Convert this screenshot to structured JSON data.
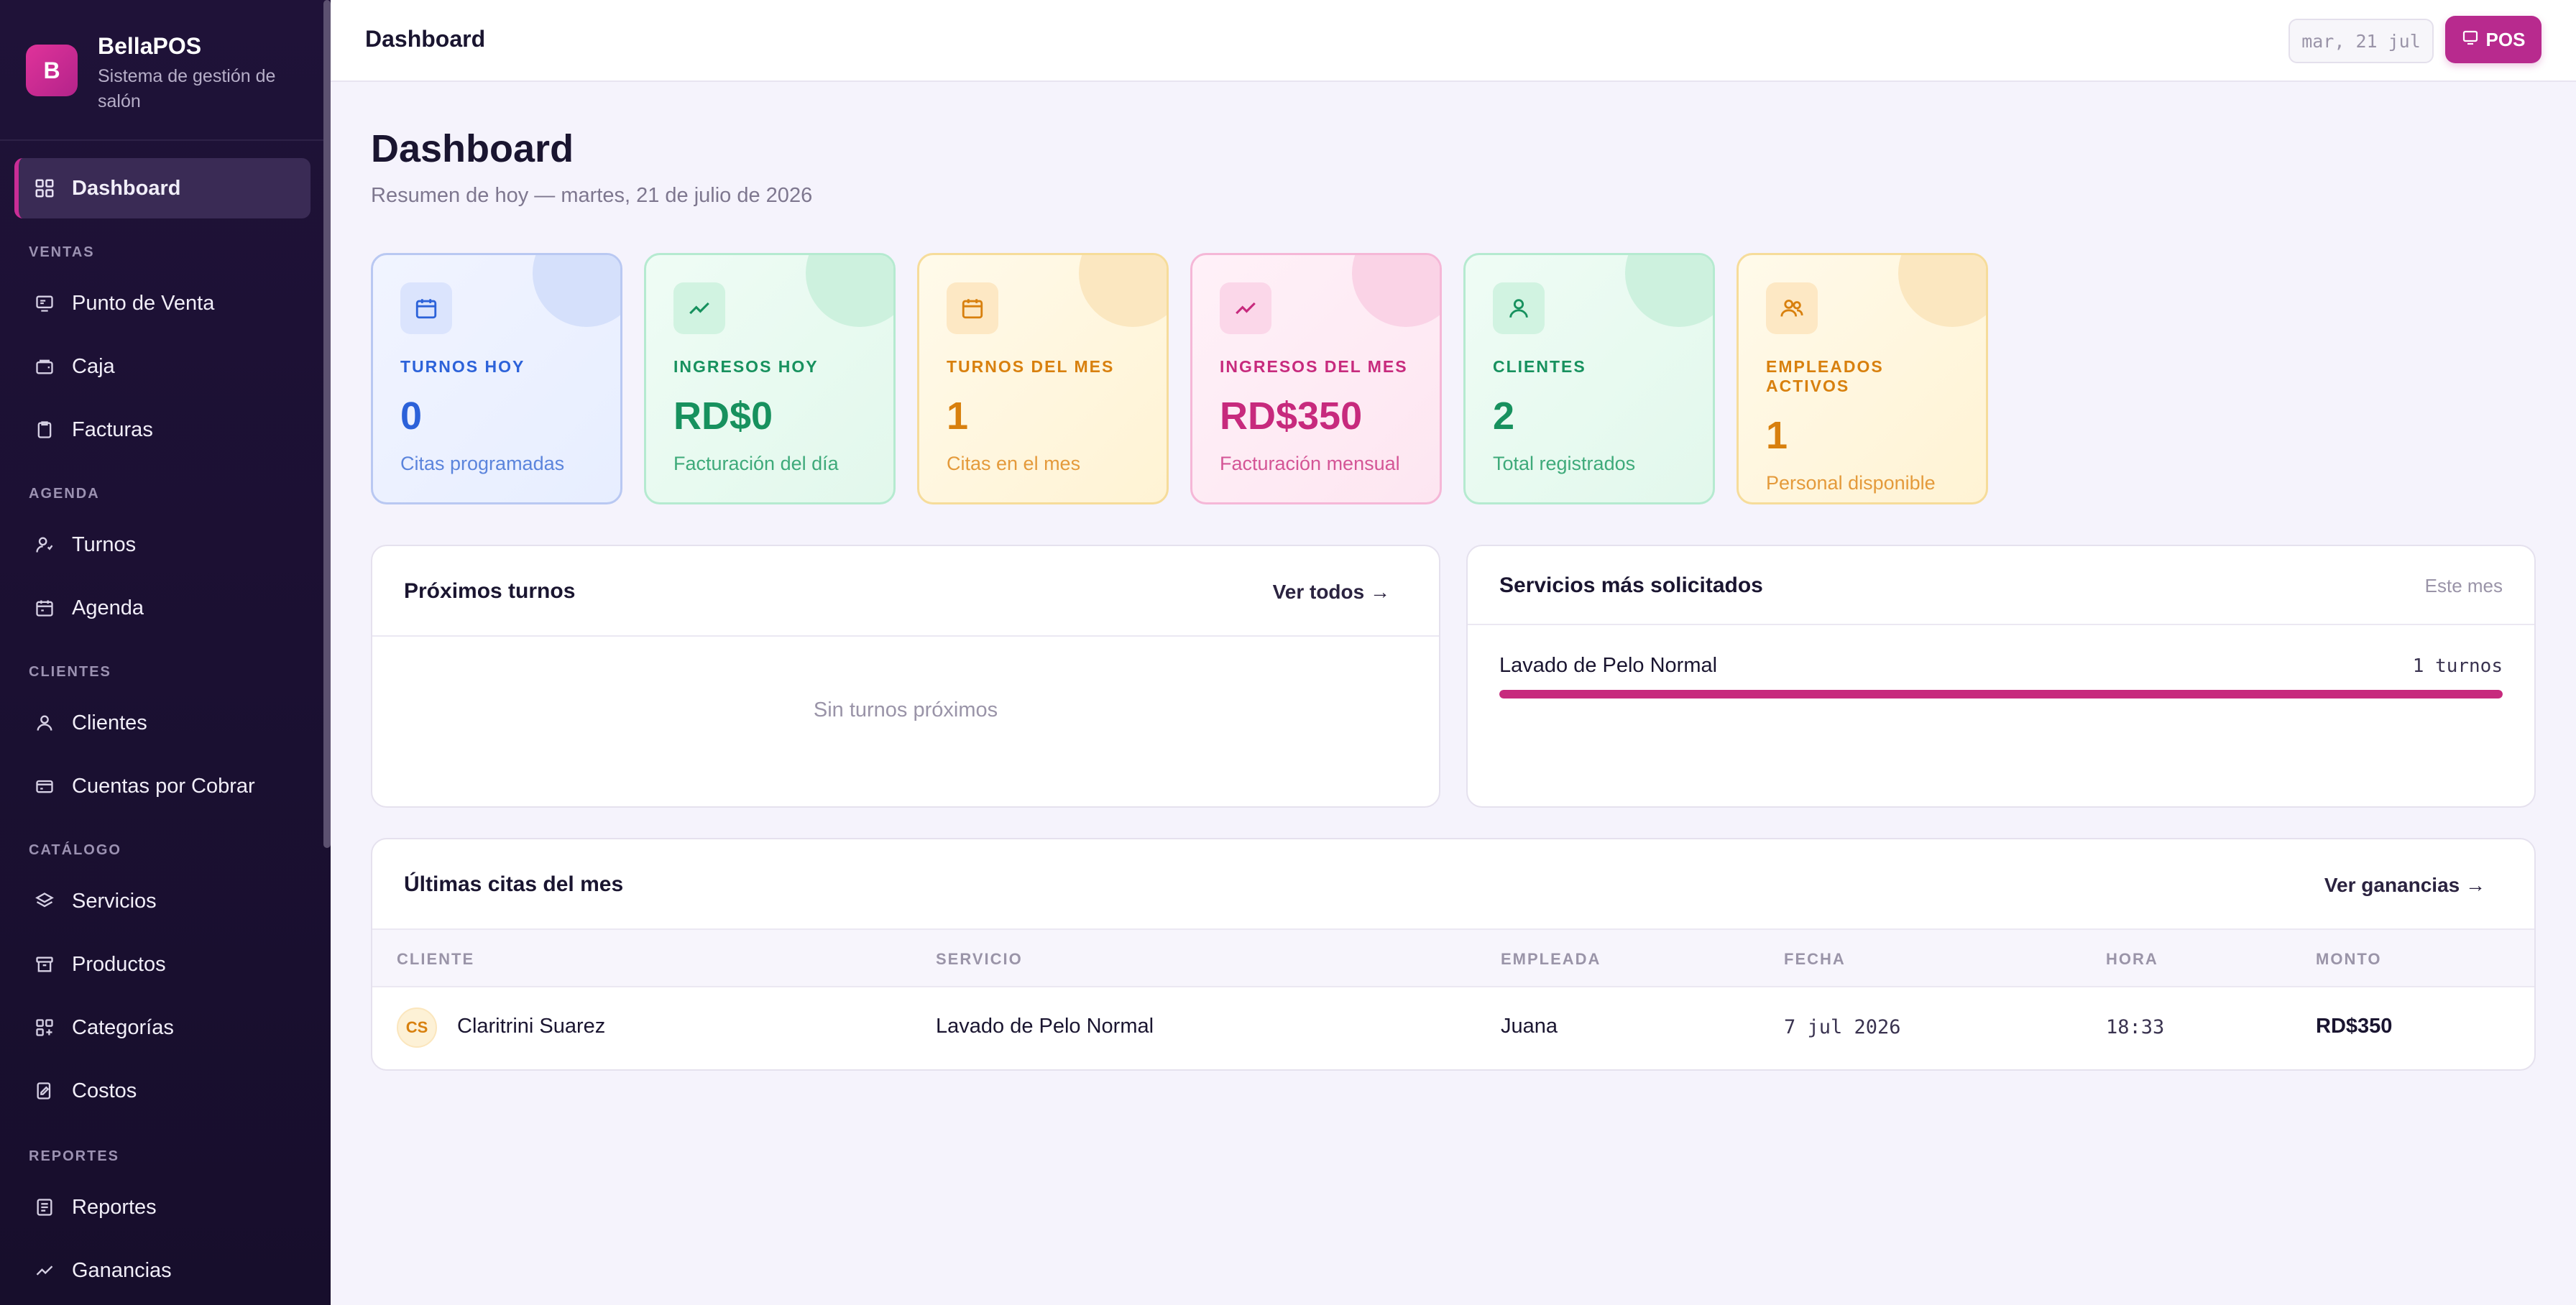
{
  "brand": {
    "initial": "B",
    "name": "BellaPOS",
    "subtitle": "Sistema de gestión de salón"
  },
  "sidebar": {
    "active": {
      "label": "Dashboard",
      "icon": "grid-icon"
    },
    "sections": [
      {
        "label": "VENTAS",
        "items": [
          {
            "label": "Punto de Venta",
            "icon": "pos-icon"
          },
          {
            "label": "Caja",
            "icon": "wallet-icon"
          },
          {
            "label": "Facturas",
            "icon": "clipboard-icon"
          }
        ]
      },
      {
        "label": "AGENDA",
        "items": [
          {
            "label": "Turnos",
            "icon": "user-clock-icon"
          },
          {
            "label": "Agenda",
            "icon": "calendar-icon"
          }
        ]
      },
      {
        "label": "CLIENTES",
        "items": [
          {
            "label": "Clientes",
            "icon": "user-icon"
          },
          {
            "label": "Cuentas por Cobrar",
            "icon": "card-icon"
          }
        ]
      },
      {
        "label": "CATÁLOGO",
        "items": [
          {
            "label": "Servicios",
            "icon": "layers-icon"
          },
          {
            "label": "Productos",
            "icon": "archive-icon"
          },
          {
            "label": "Categorías",
            "icon": "grid-plus-icon"
          },
          {
            "label": "Costos",
            "icon": "edit-doc-icon"
          }
        ]
      },
      {
        "label": "REPORTES",
        "items": [
          {
            "label": "Reportes",
            "icon": "report-icon"
          },
          {
            "label": "Ganancias",
            "icon": "trend-icon"
          }
        ]
      }
    ]
  },
  "topbar": {
    "title": "Dashboard",
    "date_chip": "mar, 21 jul",
    "pos_label": "POS"
  },
  "header": {
    "title": "Dashboard",
    "subtitle": "Resumen de hoy — martes, 21 de julio de 2026"
  },
  "stats": [
    {
      "label": "TURNOS HOY",
      "value": "0",
      "desc": "Citas programadas",
      "icon": "calendar-icon",
      "color": "#2c62d9"
    },
    {
      "label": "INGRESOS HOY",
      "value": "RD$0",
      "desc": "Facturación del día",
      "icon": "trend-icon",
      "color": "#17915e"
    },
    {
      "label": "TURNOS DEL MES",
      "value": "1",
      "desc": "Citas en el mes",
      "icon": "calendar-icon",
      "color": "#d8800e"
    },
    {
      "label": "INGRESOS DEL MES",
      "value": "RD$350",
      "desc": "Facturación mensual",
      "icon": "trend-icon",
      "color": "#c72a7d"
    },
    {
      "label": "CLIENTES",
      "value": "2",
      "desc": "Total registrados",
      "icon": "user-icon",
      "color": "#17915e"
    },
    {
      "label": "EMPLEADOS ACTIVOS",
      "value": "1",
      "desc": "Personal disponible",
      "icon": "users-icon",
      "color": "#d8800e"
    }
  ],
  "upcoming": {
    "title": "Próximos turnos",
    "link": "Ver todos →",
    "empty": "Sin turnos próximos"
  },
  "services": {
    "title": "Servicios más solicitados",
    "period": "Este mes",
    "items": [
      {
        "name": "Lavado de Pelo Normal",
        "count": "1 turnos",
        "share": 1.0
      }
    ]
  },
  "recent": {
    "title": "Últimas citas del mes",
    "link": "Ver ganancias →",
    "columns": [
      "CLIENTE",
      "SERVICIO",
      "EMPLEADA",
      "FECHA",
      "HORA",
      "MONTO"
    ],
    "rows": [
      {
        "initials": "CS",
        "cliente": "Claritrini Suarez",
        "servicio": "Lavado de Pelo Normal",
        "empleada": "Juana",
        "fecha": "7 jul 2026",
        "hora": "18:33",
        "monto": "RD$350"
      }
    ]
  }
}
